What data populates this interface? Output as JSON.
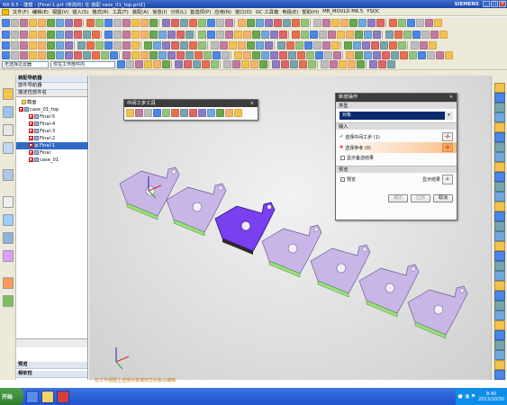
{
  "window": {
    "title": "NX 8.5 - 建模 - [Final-1.prt (修改的) 在 装配 case_01_top.prt2]",
    "brand": "SIEMENS",
    "buttons": [
      "_",
      "□",
      "×"
    ]
  },
  "menu": [
    "文件(F)",
    "编辑(E)",
    "视图(V)",
    "插入(S)",
    "格式(R)",
    "工具(T)",
    "装配(A)",
    "信息(I)",
    "分析(L)",
    "首选项(P)",
    "应用(N)",
    "窗口(O)",
    "GC 工具箱",
    "电极(E)",
    "帮助(H)",
    "MB_MOULD M6.5",
    "YSOC"
  ],
  "toolbar": {
    "filter": "无选择过滤器",
    "scope": "仅在工作部件内"
  },
  "nav": {
    "title": "装配导航器",
    "header": "部件导航器",
    "col": "描述性部件名",
    "items": [
      {
        "label": "截面"
      },
      {
        "label": "case_01_top"
      },
      {
        "label": "Final-5"
      },
      {
        "label": "Final-4"
      },
      {
        "label": "Final-3"
      },
      {
        "label": "Final-2"
      },
      {
        "label": "Final-1"
      },
      {
        "label": "Final"
      },
      {
        "label": "case_01"
      }
    ],
    "footer": [
      "预览",
      "相依性"
    ]
  },
  "midtool": {
    "title": "中间工步工具"
  },
  "dialog": {
    "title": "新增操作",
    "type_label": "类型",
    "type_value": "对象",
    "input_label": "输入",
    "row1": "选择中间工步 (1)",
    "row2": "选择参考 (0)",
    "check1": "显示备选结果",
    "preview_label": "预览",
    "preview_check": "预览",
    "show_result": "显示结果",
    "btn_apply": "确定",
    "btn_apply2": "应用",
    "btn_cancel": "取消"
  },
  "status": "在工作视图上选择对象或双击对象以编辑",
  "clock": {
    "time": "8:40",
    "date": "2013/10/30"
  },
  "start": "开始"
}
